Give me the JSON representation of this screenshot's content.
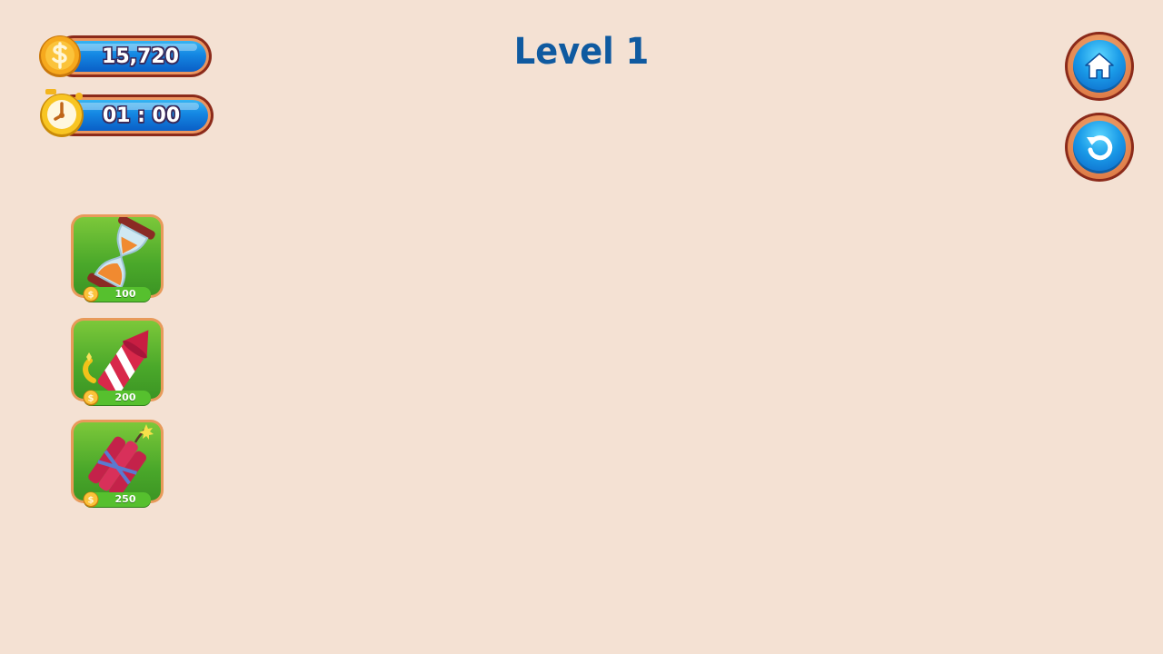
{
  "level": {
    "title": "Level 1"
  },
  "hud": {
    "coins": "15,720",
    "timer": "01 : 00"
  },
  "buttons": {
    "home_icon": "home-icon",
    "restart_icon": "restart-icon"
  },
  "boosters": [
    {
      "name": "hourglass",
      "price": "100"
    },
    {
      "name": "firework-rocket",
      "price": "200"
    },
    {
      "name": "dynamite",
      "price": "250"
    }
  ],
  "colors": {
    "background": "#f4e1d3",
    "title": "#0f5aa0",
    "hud_blue": "#1486e2",
    "booster_green": "#4aa82a"
  }
}
